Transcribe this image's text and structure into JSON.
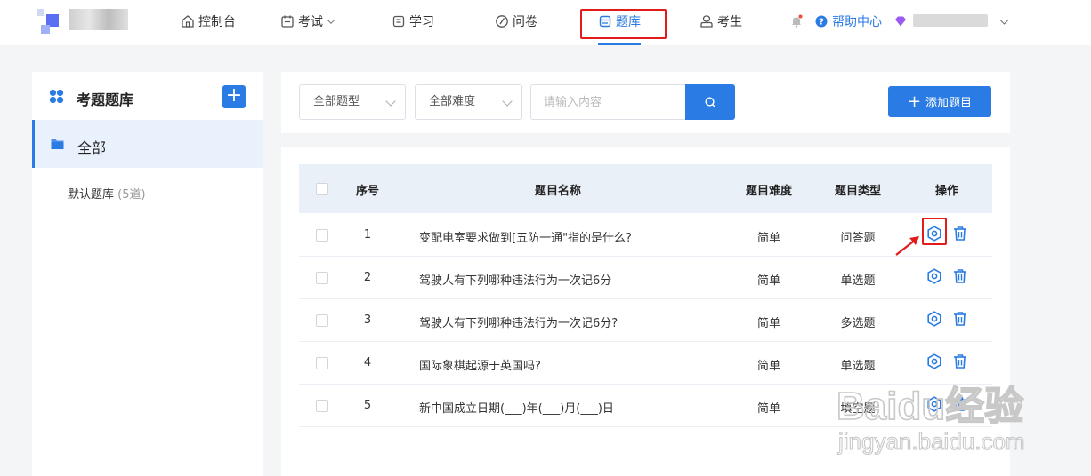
{
  "nav": {
    "items": [
      {
        "id": "dashboard",
        "label": "控制台",
        "icon": "home-icon"
      },
      {
        "id": "exam",
        "label": "考试",
        "icon": "calendar-icon"
      },
      {
        "id": "study",
        "label": "学习",
        "icon": "book-icon"
      },
      {
        "id": "survey",
        "label": "问卷",
        "icon": "pen-icon"
      },
      {
        "id": "question-bank",
        "label": "题库",
        "icon": "database-icon",
        "active": true
      },
      {
        "id": "examinee",
        "label": "考生",
        "icon": "user-icon"
      }
    ],
    "help_label": "帮助中心"
  },
  "sidebar": {
    "title": "考题题库",
    "add_symbol": "+",
    "all_label": "全部",
    "banks": [
      {
        "name": "默认题库",
        "count": "(5道)"
      }
    ]
  },
  "filters": {
    "type_select": "全部题型",
    "difficulty_select": "全部难度",
    "search_placeholder": "请输入内容",
    "add_button": "添加题目",
    "add_symbol": "+"
  },
  "table": {
    "headers": {
      "index": "序号",
      "name": "题目名称",
      "difficulty": "题目难度",
      "type": "题目类型",
      "actions": "操作"
    },
    "rows": [
      {
        "index": "1",
        "name": "变配电室要求做到[五防一通\"指的是什么?",
        "difficulty": "简单",
        "type": "问答题"
      },
      {
        "index": "2",
        "name": "驾驶人有下列哪种违法行为一次记6分",
        "difficulty": "简单",
        "type": "单选题"
      },
      {
        "index": "3",
        "name": "驾驶人有下列哪种违法行为一次记6分?",
        "difficulty": "简单",
        "type": "多选题"
      },
      {
        "index": "4",
        "name": "国际象棋起源于英国吗?",
        "difficulty": "简单",
        "type": "单选题"
      },
      {
        "index": "5",
        "name": "新中国成立日期(___)年(___)月(___)日",
        "difficulty": "简单",
        "type": "填空题"
      }
    ]
  },
  "watermark": {
    "brand": "Baidu经验",
    "url": "jingyan.baidu.com"
  },
  "colors": {
    "accent": "#2a7be4",
    "annotation": "#e21b1b",
    "sidebar_active": "#e9f1fc",
    "header_bg": "#eaf0f8"
  }
}
